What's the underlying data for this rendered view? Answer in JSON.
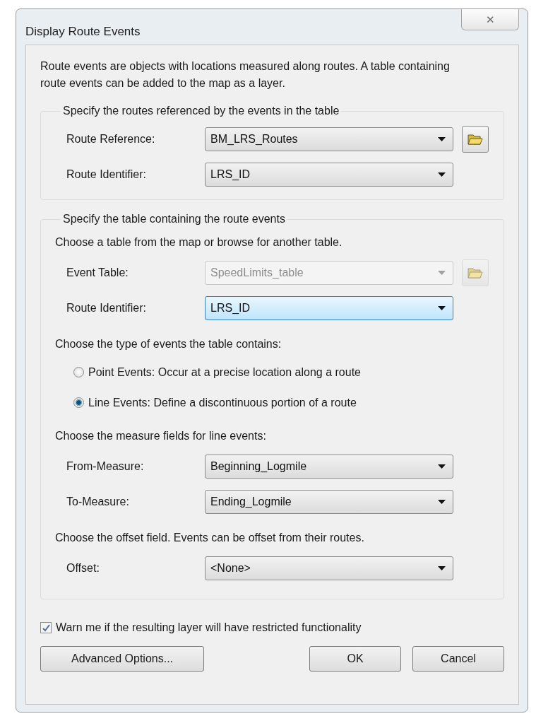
{
  "window": {
    "title": "Display Route Events",
    "close": "✕"
  },
  "description": "Route events are objects with locations measured along routes. A table containing route events can be added to the map as a layer.",
  "routes_group": {
    "legend": "Specify the routes referenced by the events in the table",
    "rows": [
      {
        "label": "Route Reference:",
        "value": "BM_LRS_Routes",
        "disabled": false,
        "focused": false,
        "browse": true
      },
      {
        "label": "Route Identifier:",
        "value": "LRS_ID",
        "disabled": false,
        "focused": false
      }
    ]
  },
  "table_group": {
    "legend": "Specify the table containing the route events",
    "sections": [
      {
        "prompt": "Choose a table from the map or browse for another table.",
        "rows": [
          {
            "label": "Event Table:",
            "value": "SpeedLimits_table",
            "disabled": true,
            "focused": false,
            "browse": true
          },
          {
            "label": "Route Identifier:",
            "value": "LRS_ID",
            "disabled": false,
            "focused": true
          }
        ]
      },
      {
        "prompt": "Choose the type of events the table contains:",
        "options": [
          {
            "label": "Point Events: Occur at a precise location along a route",
            "selected": false
          },
          {
            "label": "Line Events: Define a discontinuous portion of a route",
            "selected": true
          }
        ]
      },
      {
        "prompt": "Choose the measure fields for line events:",
        "rows": [
          {
            "label": "From-Measure:",
            "value": "Beginning_Logmile",
            "disabled": false,
            "focused": false
          },
          {
            "label": "To-Measure:",
            "value": "Ending_Logmile",
            "disabled": false,
            "focused": false
          }
        ]
      },
      {
        "prompt": "Choose the offset field. Events can be offset from their routes.",
        "rows": [
          {
            "label": "Offset:",
            "value": "<None>",
            "disabled": false,
            "focused": false
          }
        ]
      }
    ]
  },
  "warn": {
    "label": "Warn me if the resulting layer will have restricted functionality",
    "checked": true
  },
  "buttons": [
    {
      "label": "Advanced Options...",
      "kind": "left"
    },
    {
      "label": "OK",
      "kind": "right"
    },
    {
      "label": "Cancel",
      "kind": "right"
    }
  ]
}
